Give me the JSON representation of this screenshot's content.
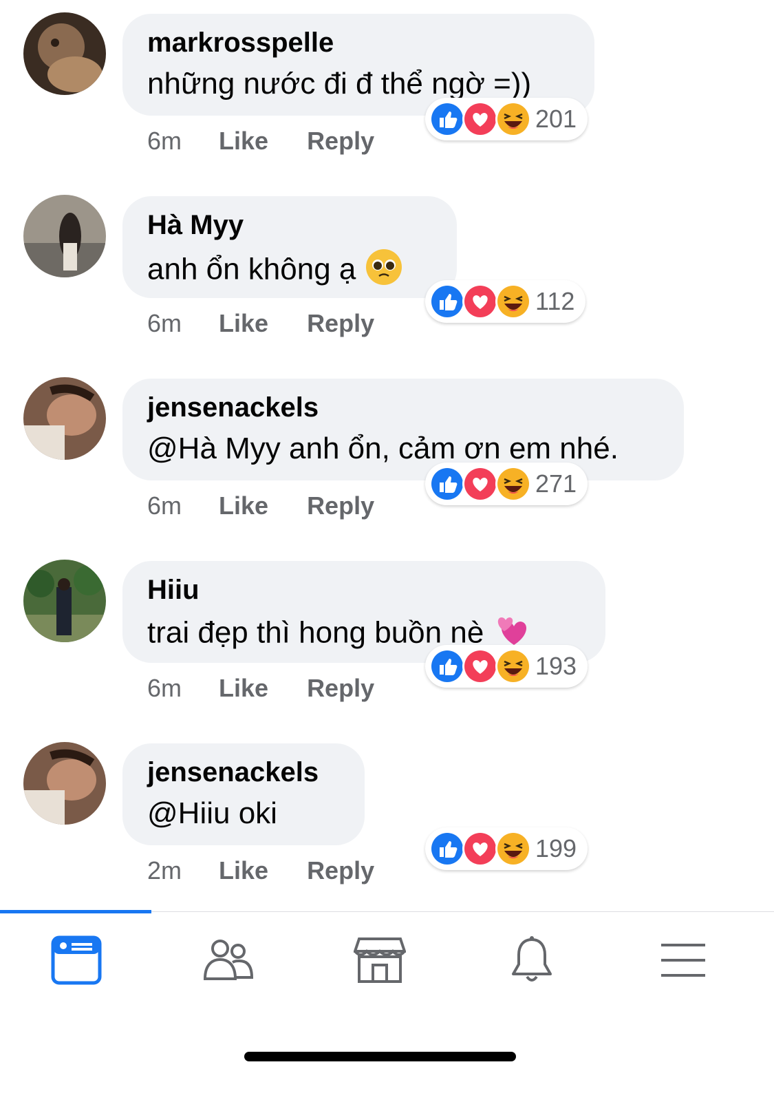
{
  "comments": [
    {
      "name": "markrosspelle",
      "text": "những nước đi đ thể ngờ =))",
      "emoji": "",
      "time": "6m",
      "like": "Like",
      "reply": "Reply",
      "reaction_count": "201"
    },
    {
      "name": "Hà Myy",
      "text": "anh ổn không ạ",
      "emoji": "pleading-face-emoji",
      "time": "6m",
      "like": "Like",
      "reply": "Reply",
      "reaction_count": "112"
    },
    {
      "name": "jensenackels",
      "text": "@Hà Myy anh ổn, cảm ơn em nhé.",
      "emoji": "",
      "time": "6m",
      "like": "Like",
      "reply": "Reply",
      "reaction_count": "271"
    },
    {
      "name": "Hiiu",
      "text": "trai đẹp thì hong buồn nè",
      "emoji": "two-hearts-emoji",
      "time": "6m",
      "like": "Like",
      "reply": "Reply",
      "reaction_count": "193"
    },
    {
      "name": "jensenackels",
      "text": "@Hiiu oki",
      "emoji": "",
      "time": "2m",
      "like": "Like",
      "reply": "Reply",
      "reaction_count": "199"
    }
  ],
  "reactions": [
    "like-icon",
    "love-icon",
    "haha-icon"
  ],
  "tabbar": {
    "tabs": [
      "home-feed-icon",
      "friends-icon",
      "marketplace-icon",
      "notifications-bell-icon",
      "menu-icon"
    ],
    "active": "home-feed-icon"
  },
  "colors": {
    "accent": "#1877f2",
    "bubble": "#f0f2f5",
    "meta": "#65676b",
    "love": "#f33e58",
    "haha": "#f7b125"
  }
}
